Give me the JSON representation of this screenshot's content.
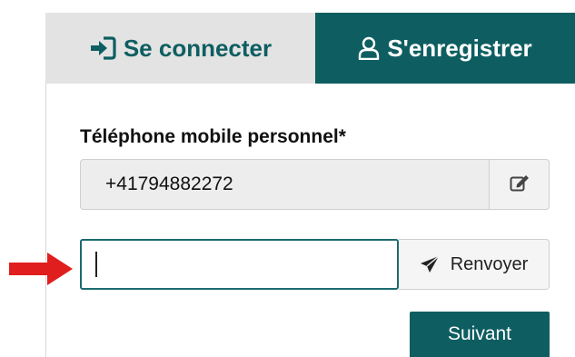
{
  "tabs": {
    "login": {
      "label": "Se connecter",
      "icon": "sign-in-icon",
      "active": false
    },
    "register": {
      "label": "S'enregistrer",
      "icon": "user-icon",
      "active": true
    }
  },
  "form": {
    "phone_label": "Téléphone mobile personnel*",
    "phone_value": "+41794882272",
    "phone_edit_icon": "edit-icon",
    "code_value": "",
    "resend_label": "Renvoyer",
    "resend_icon": "paper-plane-icon",
    "next_label": "Suivant"
  },
  "annotation": {
    "arrow_icon": "red-arrow-icon",
    "arrow_color": "#e01e1e"
  },
  "colors": {
    "accent": "#0e5e61",
    "inactive_tab": "#e3e3e3",
    "field_bg": "#ededed"
  }
}
